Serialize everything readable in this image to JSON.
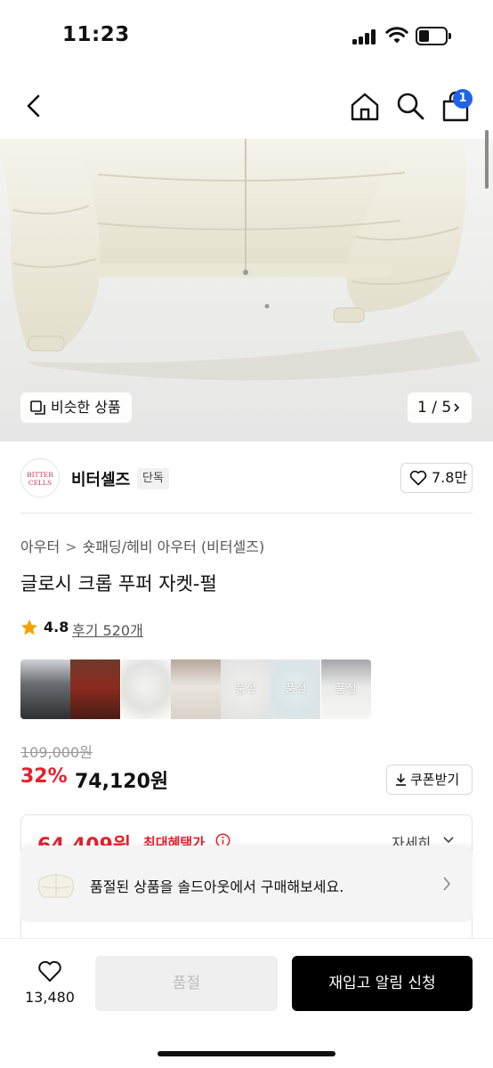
{
  "status_bar": {
    "time": "11:23"
  },
  "nav": {
    "cart_count": "1"
  },
  "hero": {
    "similar_label": "비슷한 상품",
    "pager": "1 / 5"
  },
  "brand": {
    "logo_line1": "BITTER",
    "logo_line2": "CELLS",
    "name": "비터셀즈",
    "exclusive_tag": "단독",
    "likes": "7.8만"
  },
  "breadcrumb": {
    "category": "아우터",
    "subcategory": "숏패딩/헤비 아우터 (비터셀즈)"
  },
  "product": {
    "title": "글로시 크롭 푸퍼 자켓-펄"
  },
  "rating": {
    "score": "4.8",
    "reviews": "후기 520개"
  },
  "thumbnails": [
    {
      "label": ""
    },
    {
      "label": ""
    },
    {
      "label": ""
    },
    {
      "label": ""
    },
    {
      "label": "품절"
    },
    {
      "label": "품절"
    },
    {
      "label": "품절"
    }
  ],
  "price": {
    "original": "109,000원",
    "discount": "32%",
    "sale": "74,120원",
    "coupon_label": "쿠폰받기"
  },
  "benefit": {
    "amount": "64,409원",
    "label": "최대혜택가",
    "detail": "자세히"
  },
  "soldout_banner": {
    "text": "품절된 상품을 솔드아웃에서 구매해보세요."
  },
  "bottom_bar": {
    "wish_count": "13,480",
    "soldout_label": "품절",
    "restock_label": "재입고 알림 신청"
  },
  "colors": {
    "accent_red": "#e5202c",
    "badge_blue": "#1e63e9",
    "primary_black": "#000000"
  },
  "icons": [
    "back-icon",
    "home-icon",
    "search-icon",
    "cart-icon",
    "similar-icon",
    "chevron-right-icon",
    "heart-icon",
    "star-icon",
    "download-icon",
    "info-icon",
    "chevron-down-icon"
  ]
}
